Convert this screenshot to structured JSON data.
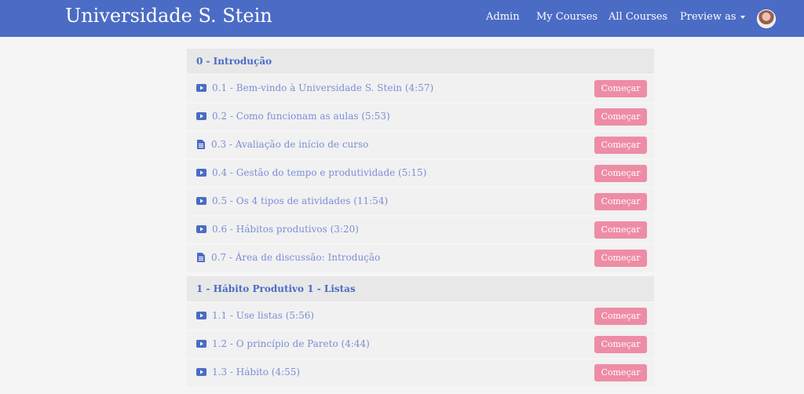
{
  "header": {
    "brand": "Universidade S. Stein",
    "nav": {
      "admin": "Admin",
      "my_courses": "My Courses",
      "all_courses": "All Courses",
      "preview_as": "Preview as"
    }
  },
  "colors": {
    "primary": "#4b6cc5",
    "button": "#ee8ca6",
    "item_text": "#7b8fd6"
  },
  "sections": [
    {
      "title": "0 - Introdução",
      "items": [
        {
          "icon": "video-icon",
          "label": "0.1 - Bem-vindo à Universidade S. Stein (4:57)",
          "button": "Começar"
        },
        {
          "icon": "video-icon",
          "label": "0.2 - Como funcionam as aulas (5:53)",
          "button": "Começar"
        },
        {
          "icon": "document-icon",
          "label": "0.3 - Avaliação de início de curso",
          "button": "Começar"
        },
        {
          "icon": "video-icon",
          "label": "0.4 - Gestão do tempo e produtividade (5:15)",
          "button": "Começar"
        },
        {
          "icon": "video-icon",
          "label": "0.5 - Os 4 tipos de atividades (11:54)",
          "button": "Começar"
        },
        {
          "icon": "video-icon",
          "label": "0.6 - Hábitos produtivos (3:20)",
          "button": "Começar"
        },
        {
          "icon": "document-icon",
          "label": "0.7 - Área de discussão: Introdução",
          "button": "Começar"
        }
      ]
    },
    {
      "title": "1 - Hábito Produtivo 1 - Listas",
      "items": [
        {
          "icon": "video-icon",
          "label": "1.1 - Use listas (5:56)",
          "button": "Começar"
        },
        {
          "icon": "video-icon",
          "label": "1.2 - O princípio de Pareto (4:44)",
          "button": "Começar"
        },
        {
          "icon": "video-icon",
          "label": "1.3 - Hábito (4:55)",
          "button": "Começar"
        }
      ]
    }
  ]
}
